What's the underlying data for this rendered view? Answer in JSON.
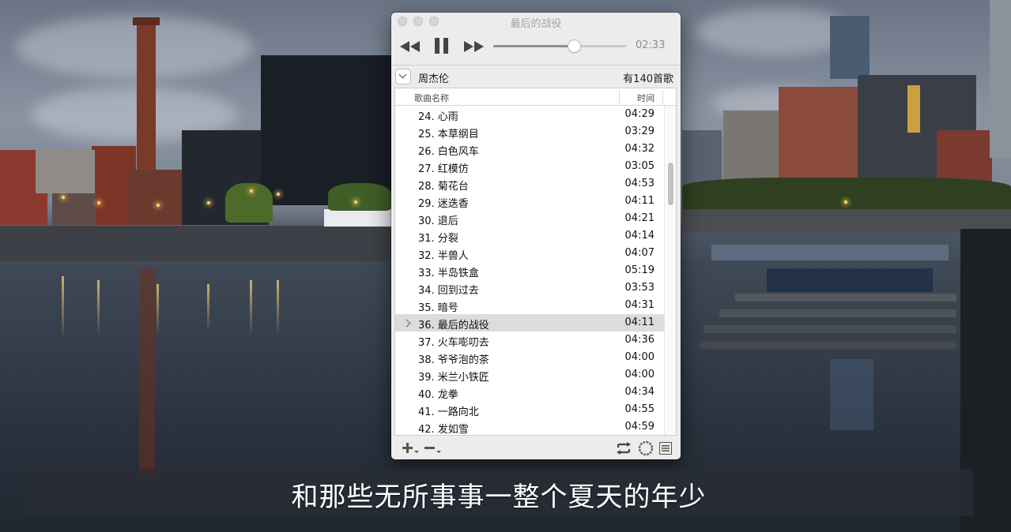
{
  "window": {
    "title": "最后的战役"
  },
  "transport": {
    "elapsed": "02:33",
    "progress_fraction": 0.61,
    "state": "playing"
  },
  "playlist": {
    "artist": "周杰伦",
    "song_count": "有140首歌",
    "columns": {
      "name": "歌曲名称",
      "time": "时间"
    },
    "songs": [
      {
        "title": "24. 心雨",
        "duration": "04:29"
      },
      {
        "title": "25. 本草纲目",
        "duration": "03:29"
      },
      {
        "title": "26. 白色风车",
        "duration": "04:32"
      },
      {
        "title": "27. 红模仿",
        "duration": "03:05"
      },
      {
        "title": "28. 菊花台",
        "duration": "04:53"
      },
      {
        "title": "29. 迷迭香",
        "duration": "04:11"
      },
      {
        "title": "30. 退后",
        "duration": "04:21"
      },
      {
        "title": "31. 分裂",
        "duration": "04:14"
      },
      {
        "title": "32. 半兽人",
        "duration": "04:07"
      },
      {
        "title": "33. 半岛铁盒",
        "duration": "05:19"
      },
      {
        "title": "34. 回到过去",
        "duration": "03:53"
      },
      {
        "title": "35. 暗号",
        "duration": "04:31"
      },
      {
        "title": "36. 最后的战役",
        "duration": "04:11"
      },
      {
        "title": "37. 火车嘭叨去",
        "duration": "04:36"
      },
      {
        "title": "38. 爷爷泡的茶",
        "duration": "04:00"
      },
      {
        "title": "39. 米兰小铁匠",
        "duration": "04:00"
      },
      {
        "title": "40. 龙拳",
        "duration": "04:34"
      },
      {
        "title": "41. 一路向北",
        "duration": "04:55"
      },
      {
        "title": "42. 发如雪",
        "duration": "04:59"
      }
    ],
    "selected_index": 12
  },
  "bottom_bar": {
    "add_label": "+",
    "remove_label": "−"
  },
  "subtitle": {
    "text": "和那些无所事事一整个夏天的年少"
  }
}
